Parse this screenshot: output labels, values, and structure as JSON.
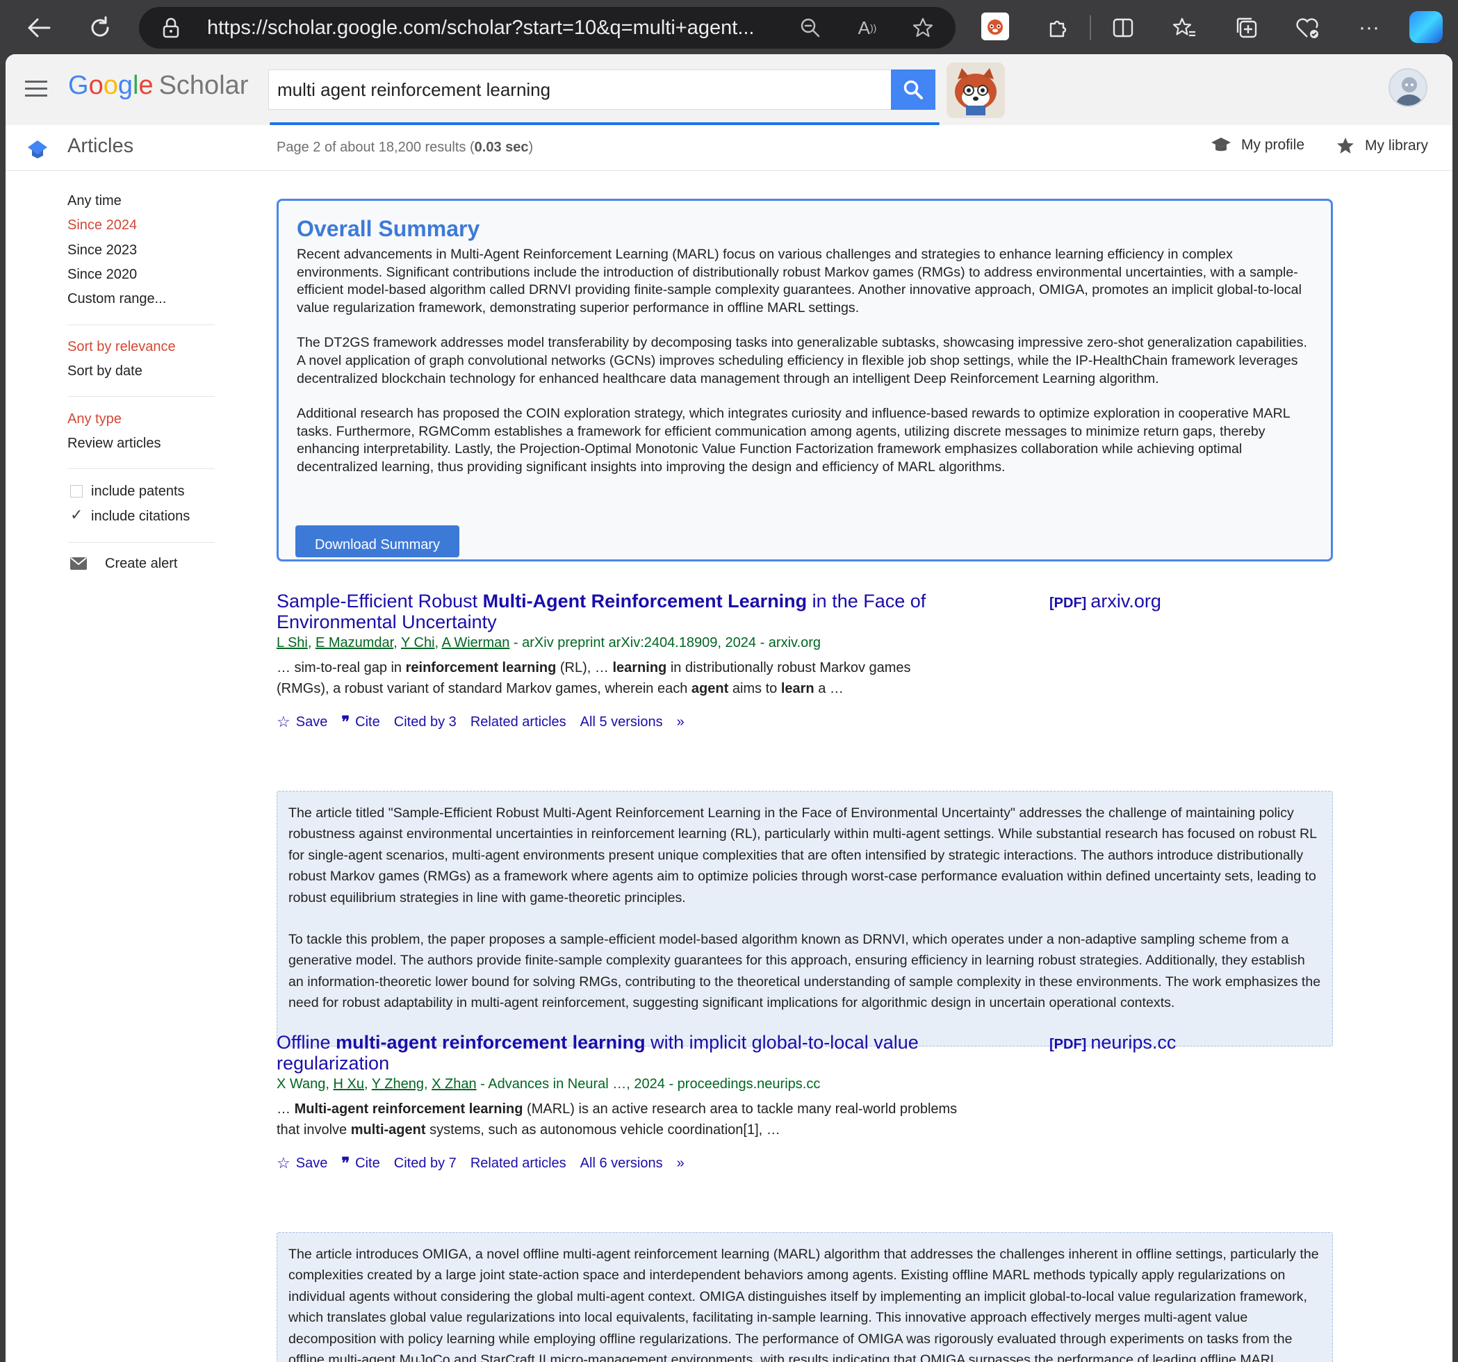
{
  "browser": {
    "url": "https://scholar.google.com/scholar?start=10&q=multi+agent..."
  },
  "header": {
    "logo_google": [
      "G",
      "o",
      "o",
      "g",
      "l",
      "e"
    ],
    "logo_scholar": "Scholar",
    "search_value": "multi agent reinforcement learning"
  },
  "subheader": {
    "section": "Articles",
    "stats_prefix": "Page 2 of about 18,200 results (",
    "stats_time": "0.03 sec",
    "stats_suffix": ")",
    "my_profile": "My profile",
    "my_library": "My library"
  },
  "sidebar": {
    "time_filters": [
      "Any time",
      "Since 2024",
      "Since 2023",
      "Since 2020",
      "Custom range..."
    ],
    "sort_options": [
      "Sort by relevance",
      "Sort by date"
    ],
    "type_options": [
      "Any type",
      "Review articles"
    ],
    "include_patents": "include patents",
    "include_citations": "include citations",
    "create_alert": "Create alert"
  },
  "summary": {
    "title": "Overall Summary",
    "paragraphs": [
      "Recent advancements in Multi-Agent Reinforcement Learning (MARL) focus on various challenges and strategies to enhance learning efficiency in complex environments. Significant contributions include the introduction of distributionally robust Markov games (RMGs) to address environmental uncertainties, with a sample-efficient model-based algorithm called DRNVI providing finite-sample complexity guarantees. Another innovative approach, OMIGA, promotes an implicit global-to-local value regularization framework, demonstrating superior performance in offline MARL settings.",
      "The DT2GS framework addresses model transferability by decomposing tasks into generalizable subtasks, showcasing impressive zero-shot generalization capabilities. A novel application of graph convolutional networks (GCNs) improves scheduling efficiency in flexible job shop settings, while the IP-HealthChain framework leverages decentralized blockchain technology for enhanced healthcare data management through an intelligent Deep Reinforcement Learning algorithm.",
      "Additional research has proposed the COIN exploration strategy, which integrates curiosity and influence-based rewards to optimize exploration in cooperative MARL tasks. Furthermore, RGMComm establishes a framework for efficient communication among agents, utilizing discrete messages to minimize return gaps, thereby enhancing interpretability. Lastly, the Projection-Optimal Monotonic Value Function Factorization framework emphasizes collaboration while achieving optimal decentralized learning, thus providing significant insights into improving the design and efficiency of MARL algorithms."
    ],
    "download_label": "Download Summary"
  },
  "results": [
    {
      "title_parts": [
        {
          "t": "Sample-Efficient Robust ",
          "b": false
        },
        {
          "t": "Multi-Agent Reinforcement Learning",
          "b": true
        },
        {
          "t": " in the Face of Environmental Uncertainty",
          "b": false
        }
      ],
      "pdf_tag": "[PDF]",
      "pdf_source": "arxiv.org",
      "authors": [
        "L Shi",
        "E Mazumdar",
        "Y Chi",
        "A Wierman"
      ],
      "venue": " - arXiv preprint arXiv:2404.18909, 2024 - arxiv.org",
      "snippet_parts": [
        {
          "t": "… sim-to-real gap in ",
          "b": false
        },
        {
          "t": "reinforcement learning",
          "b": true
        },
        {
          "t": " (RL), … ",
          "b": false
        },
        {
          "t": "learning",
          "b": true
        },
        {
          "t": " in distributionally robust Markov games (RMGs), a robust variant of standard Markov games, wherein each ",
          "b": false
        },
        {
          "t": "agent",
          "b": true
        },
        {
          "t": " aims to ",
          "b": false
        },
        {
          "t": "learn",
          "b": true
        },
        {
          "t": " a …",
          "b": false
        }
      ],
      "actions": {
        "save": "Save",
        "cite": "Cite",
        "cited_by": "Cited by 3",
        "related": "Related articles",
        "versions": "All 5 versions"
      },
      "ai_summary": [
        "The article titled \"Sample-Efficient Robust Multi-Agent Reinforcement Learning in the Face of Environmental Uncertainty\" addresses the challenge of maintaining policy robustness against environmental uncertainties in reinforcement learning (RL), particularly within multi-agent settings. While substantial research has focused on robust RL for single-agent scenarios, multi-agent environments present unique complexities that are often intensified by strategic interactions. The authors introduce distributionally robust Markov games (RMGs) as a framework where agents aim to optimize policies through worst-case performance evaluation within defined uncertainty sets, leading to robust equilibrium strategies in line with game-theoretic principles.",
        "To tackle this problem, the paper proposes a sample-efficient model-based algorithm known as DRNVI, which operates under a non-adaptive sampling scheme from a generative model. The authors provide finite-sample complexity guarantees for this approach, ensuring efficiency in learning robust strategies. Additionally, they establish an information-theoretic lower bound for solving RMGs, contributing to the theoretical understanding of sample complexity in these environments. The work emphasizes the need for robust adaptability in multi-agent reinforcement, suggesting significant implications for algorithmic design in uncertain operational contexts."
      ]
    },
    {
      "title_parts": [
        {
          "t": "Offline ",
          "b": false
        },
        {
          "t": "multi-agent reinforcement learning",
          "b": true
        },
        {
          "t": " with implicit global-to-local value regularization",
          "b": false
        }
      ],
      "pdf_tag": "[PDF]",
      "pdf_source": "neurips.cc",
      "authors": [
        "X Wang",
        "H Xu",
        "Y Zheng",
        "X Zhan"
      ],
      "venue": " - Advances in Neural …, 2024 - proceedings.neurips.cc",
      "snippet_parts": [
        {
          "t": "… ",
          "b": false
        },
        {
          "t": "Multi-agent reinforcement learning",
          "b": true
        },
        {
          "t": " (MARL) is an active research area to tackle many real-world problems that involve ",
          "b": false
        },
        {
          "t": "multi-agent",
          "b": true
        },
        {
          "t": " systems, such as autonomous vehicle coordination[1], …",
          "b": false
        }
      ],
      "actions": {
        "save": "Save",
        "cite": "Cite",
        "cited_by": "Cited by 7",
        "related": "Related articles",
        "versions": "All 6 versions"
      },
      "ai_summary": [
        "The article introduces OMIGA, a novel offline multi-agent reinforcement learning (MARL) algorithm that addresses the challenges inherent in offline settings, particularly the complexities created by a large joint state-action space and interdependent behaviors among agents. Existing offline MARL methods typically apply regularizations on individual agents without considering the global multi-agent context. OMIGA distinguishes itself by implementing an implicit global-to-local value regularization framework, which translates global value regularizations into local equivalents, facilitating in-sample learning. This innovative approach effectively merges multi-agent value decomposition with policy learning while employing offline regularizations. The performance of OMIGA was rigorously evaluated through experiments on tasks from the offline multi-agent MuJoCo and StarCraft II micro-management environments, with results indicating that OMIGA surpasses the performance of leading offline MARL techniques across nearly all assessed tasks. This work marks a significant advancement in offline MARL, demonstrating enhanced efficiency and effectiveness in policy optimization within multi-agent systems without the need for real-time environmental"
      ]
    }
  ]
}
